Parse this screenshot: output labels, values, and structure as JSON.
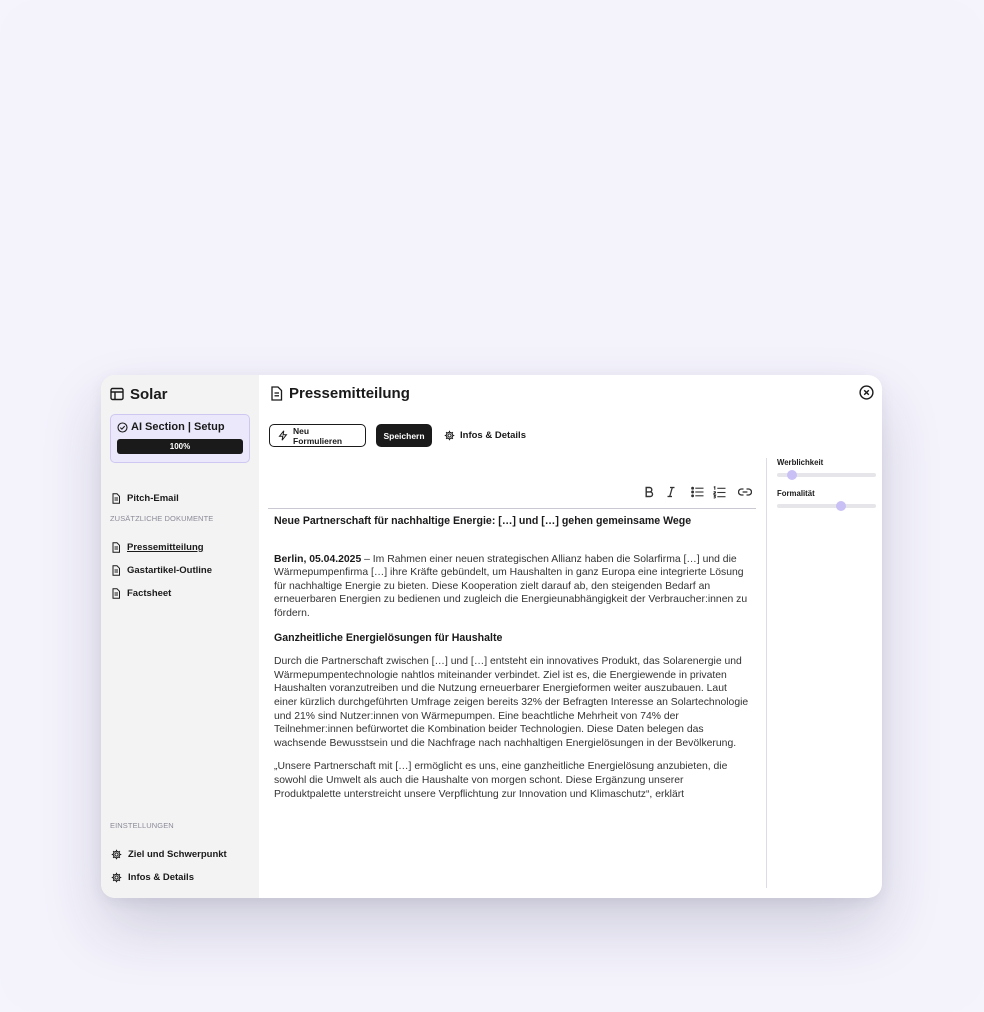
{
  "brand": {
    "name": "Solar"
  },
  "setup": {
    "title": "AI Section | Setup",
    "progress_label": "100%",
    "progress": 1.0
  },
  "sidebar": {
    "top_item": "Pitch-Email",
    "section_docs": "ZUSÄTZLICHE DOKUMENTE",
    "docs": [
      "Pressemitteilung",
      "Gastartikel-Outline",
      "Factsheet"
    ],
    "section_settings": "EINSTELLUNGEN",
    "settings": [
      "Ziel und Schwerpunkt",
      "Infos & Details"
    ]
  },
  "document": {
    "title": "Pressemitteilung",
    "buttons": {
      "rephrase": "Neu Formulieren",
      "save": "Speichern",
      "info": "Infos & Details"
    }
  },
  "formatting": [
    "bold-icon",
    "italic-icon",
    "bullet-list-icon",
    "numbered-list-icon",
    "link-icon"
  ],
  "editor": {
    "headline": "Neue Partnerschaft für nachhaltige Energie: […] und […] gehen gemeinsame Wege",
    "dateline": "Berlin, 05.04.2025",
    "p1": " – Im Rahmen einer neuen strategischen Allianz haben die Solarfirma […] und die Wärmepumpenfirma […] ihre Kräfte gebündelt, um Haushalten in ganz Europa eine integrierte Lösung für nachhaltige Energie zu bieten. Diese Kooperation zielt darauf ab, den steigenden Bedarf an erneuerbaren Energien zu bedienen und zugleich die Energieunabhängigkeit der Verbraucher:innen zu fördern.",
    "subheading": "Ganzheitliche Energielösungen für Haushalte",
    "p2": "Durch die Partnerschaft zwischen […] und […] entsteht ein innovatives Produkt, das Solarenergie und Wärmepumpentechnologie nahtlos miteinander verbindet. Ziel ist es, die Energiewende in privaten Haushalten voranzutreiben und die Nutzung erneuerbarer Energieformen weiter auszubauen. Laut einer kürzlich durchgeführten Umfrage zeigen bereits 32% der Befragten Interesse an Solartechnologie und 21% sind Nutzer:innen von Wärmepumpen. Eine beachtliche Mehrheit von 74% der Teilnehmer:innen befürwortet die Kombination beider Technologien. Diese Daten belegen das wachsende Bewusstsein und die Nachfrage nach nachhaltigen Energielösungen in der Bevölkerung.",
    "p3": "„Unsere Partnerschaft mit […] ermöglicht es uns, eine ganzheitliche Energielösung anzubieten, die sowohl die Umwelt als auch die Haushalte von morgen schont. Diese Ergänzung unserer Produktpalette unterstreicht unsere Verpflichtung zur Innovation und Klimaschutz“, erklärt"
  },
  "sliders": [
    {
      "label": "Werblichkeit",
      "value": 0.15
    },
    {
      "label": "Formalität",
      "value": 0.65
    }
  ],
  "colors": {
    "accent": "#c9c0f5",
    "setup_bg": "#ebe8fb",
    "sidebar_bg": "#f3f3f3",
    "dark": "#1a1a1a"
  }
}
